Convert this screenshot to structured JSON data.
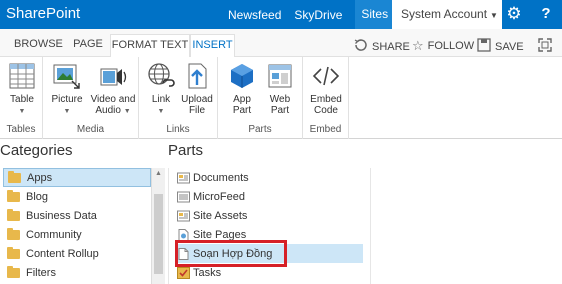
{
  "suitebar": {
    "brand": "SharePoint",
    "links": [
      "Newsfeed",
      "SkyDrive",
      "Sites"
    ],
    "account": "System Account",
    "gear_icon": "gear-icon",
    "help_label": "?"
  },
  "ribbon_tabs": {
    "browse": "BROWSE",
    "page": "PAGE",
    "format_text": "FORMAT TEXT",
    "insert": "INSERT",
    "share": "SHARE",
    "follow": "FOLLOW",
    "save": "SAVE"
  },
  "ribbon": {
    "tables": {
      "table_label": "Table",
      "group": "Tables"
    },
    "media": {
      "picture_label": "Picture",
      "video_label": "Video and",
      "video_label2": "Audio",
      "group": "Media"
    },
    "links": {
      "link_label": "Link",
      "upload_label": "Upload",
      "upload_label2": "File",
      "group": "Links"
    },
    "parts": {
      "app_label": "App",
      "app_label2": "Part",
      "web_label": "Web",
      "web_label2": "Part",
      "group": "Parts"
    },
    "embed": {
      "embed_label": "Embed",
      "embed_label2": "Code",
      "group": "Embed"
    }
  },
  "categories": {
    "title": "Categories",
    "items": [
      "Apps",
      "Blog",
      "Business Data",
      "Community",
      "Content Rollup",
      "Filters"
    ],
    "selected": "Apps"
  },
  "parts": {
    "title": "Parts",
    "items": [
      "Documents",
      "MicroFeed",
      "Site Assets",
      "Site Pages",
      "Soạn Hợp Đồng",
      "Tasks"
    ],
    "selected": "Soạn Hợp Đồng"
  },
  "colors": {
    "suite_blue": "#0072c6",
    "highlight_red": "#d62027",
    "selection": "#cde6f7"
  }
}
